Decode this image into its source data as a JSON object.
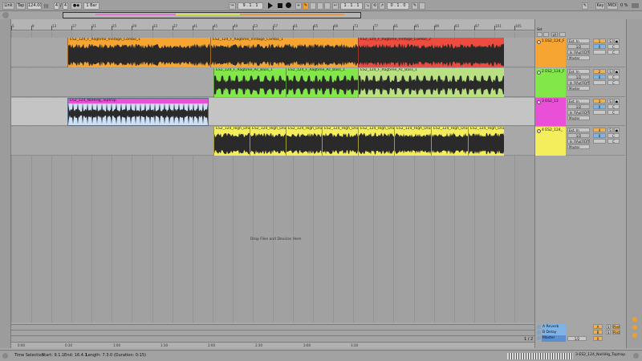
{
  "transport": {
    "link": "Link",
    "tap": "Tap",
    "tempo": "124.00",
    "signature_num": "4",
    "signature_den": "4",
    "quantize": "1 Bar",
    "position": "9 . 1 . 1",
    "loop_start": "1 . 1 . 1",
    "loop_length": "0 . 1 . 0",
    "key": "Key",
    "midi": "MIDI",
    "cpu": "0 %"
  },
  "ruler": {
    "bars": [
      "5",
      "9",
      "13",
      "17",
      "21",
      "25",
      "29",
      "33",
      "37",
      "41",
      "45",
      "49",
      "53",
      "57",
      "61",
      "65",
      "69",
      "73",
      "77",
      "81",
      "85",
      "89",
      "93",
      "97",
      "101",
      "105"
    ],
    "times": [
      "0:00",
      "0:30",
      "1:00",
      "1:30",
      "2:00",
      "2:30",
      "3:00",
      "3:30"
    ]
  },
  "tracks": [
    {
      "name": "1 ES2_124_F",
      "number": "1",
      "color": "#f6a533",
      "clips": [
        {
          "name": "ES2_124_F_Ragtime_Vintage_Combo_1",
          "color": "#f6a533"
        },
        {
          "name": "ES2_124_F_Ragtime_Vintage_Combo_1",
          "color": "#f6a533"
        },
        {
          "name": "ES2_124_F_Ragtime_Vintage_Combo_2",
          "color": "#ee4c3f"
        }
      ]
    },
    {
      "name": "2 ES2_124_F",
      "number": "2",
      "color": "#82e84a",
      "clips": [
        {
          "name": "ES2_124_F_Ragtime_Ac_Bass_1",
          "color": "#82e84a"
        },
        {
          "name": "ES2_124_F_Ragtime_Ac_Bass_1",
          "color": "#82e84a"
        },
        {
          "name": "ES2_124_F_Ragtime_Ac_Bass_1",
          "color": "#b9e081"
        }
      ]
    },
    {
      "name": "3 ES2_12",
      "number": "3",
      "color": "#ea4fd8",
      "clips": [
        {
          "name": "ES2_124_NoHiHg_Toptrop",
          "color": "#ea4fd8"
        }
      ]
    },
    {
      "name": "4 ES2_124_",
      "number": "4",
      "color": "#f4ee5c",
      "clips": [
        {
          "name": "ES2_124_High_Drums_",
          "color": "#f4ee5c"
        },
        {
          "name": "ES2_124_High_Drums_",
          "color": "#f4ee5c"
        },
        {
          "name": "ES2_124_High_Drums_",
          "color": "#f4ee5c"
        },
        {
          "name": "ES2_124_High_Drums_",
          "color": "#f4ee5c"
        },
        {
          "name": "ES2_124_High_Drums_",
          "color": "#f4ee5c"
        },
        {
          "name": "ES2_124_High_Drums_",
          "color": "#f4ee5c"
        },
        {
          "name": "ES2_124_High_Drums_",
          "color": "#f4ee5c"
        },
        {
          "name": "ES2_124_High_Drums_",
          "color": "#f4ee5c"
        }
      ]
    }
  ],
  "mixer": {
    "input_type": "Ext. In",
    "channel": "1/2",
    "monitor_out": "Master",
    "in_label": "In",
    "auto_label": "Auto",
    "off_label": "Off",
    "volume": "0",
    "sends": [
      "C",
      "C"
    ],
    "solo": "S",
    "arm": "●"
  },
  "returns": [
    {
      "name": "A Reverb",
      "letter": "A"
    },
    {
      "name": "B Delay",
      "letter": "B"
    },
    {
      "name": "Master",
      "letter": ""
    }
  ],
  "drop_hint": "Drop Files and Devices Here",
  "page_indicator": "1 / 2",
  "master_out": "1/2",
  "status": {
    "label": "Time Selection",
    "start": "Start: 9.1.1",
    "end": "End: 16.4.1",
    "length": "Length: 7.3.0 (Duration: 0:15)",
    "selected_clip": "3-ES2_124_NoHiHg_Toptrop"
  },
  "colors": {
    "orange": "#f6a533",
    "red": "#ee4c3f",
    "green": "#82e84a",
    "pink": "#ea4fd8",
    "yellow": "#f4ee5c",
    "blue_selected": "#cde0f5"
  }
}
